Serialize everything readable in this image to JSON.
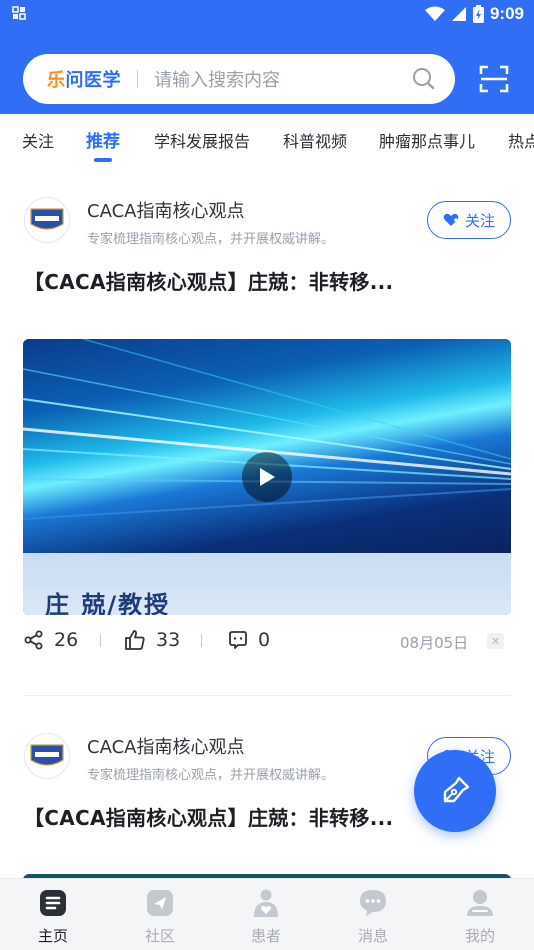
{
  "status": {
    "time": "9:09"
  },
  "search": {
    "brand_part1": "乐",
    "brand_part2": "问医学",
    "placeholder": "请输入搜索内容"
  },
  "tabs": [
    {
      "label": "关注",
      "active": false
    },
    {
      "label": "推荐",
      "active": true
    },
    {
      "label": "学科发展报告",
      "active": false
    },
    {
      "label": "科普视频",
      "active": false
    },
    {
      "label": "肿瘤那点事儿",
      "active": false
    },
    {
      "label": "热点",
      "active": false
    }
  ],
  "posts": [
    {
      "author": "CACA指南核心观点",
      "author_desc": "专家梳理指南核心观点，并开展权威讲解。",
      "follow_label": "关注",
      "title": "【CACA指南核心观点】庄兢：非转移...",
      "video_caption": "庄 兢/教授",
      "shares": "26",
      "likes": "33",
      "comments": "0",
      "date": "08月05日"
    },
    {
      "author": "CACA指南核心观点",
      "author_desc": "专家梳理指南核心观点，并开展权威讲解。",
      "follow_label": "关注",
      "title": "【CACA指南核心观点】庄兢：非转移..."
    }
  ],
  "bottom_nav": [
    {
      "label": "主页",
      "icon": "home-icon",
      "active": true
    },
    {
      "label": "社区",
      "icon": "community-icon",
      "active": false
    },
    {
      "label": "患者",
      "icon": "patient-icon",
      "active": false
    },
    {
      "label": "消息",
      "icon": "message-icon",
      "active": false
    },
    {
      "label": "我的",
      "icon": "profile-icon",
      "active": false
    }
  ],
  "colors": {
    "primary": "#2f6ef5",
    "brand_orange": "#ff8a1f"
  }
}
